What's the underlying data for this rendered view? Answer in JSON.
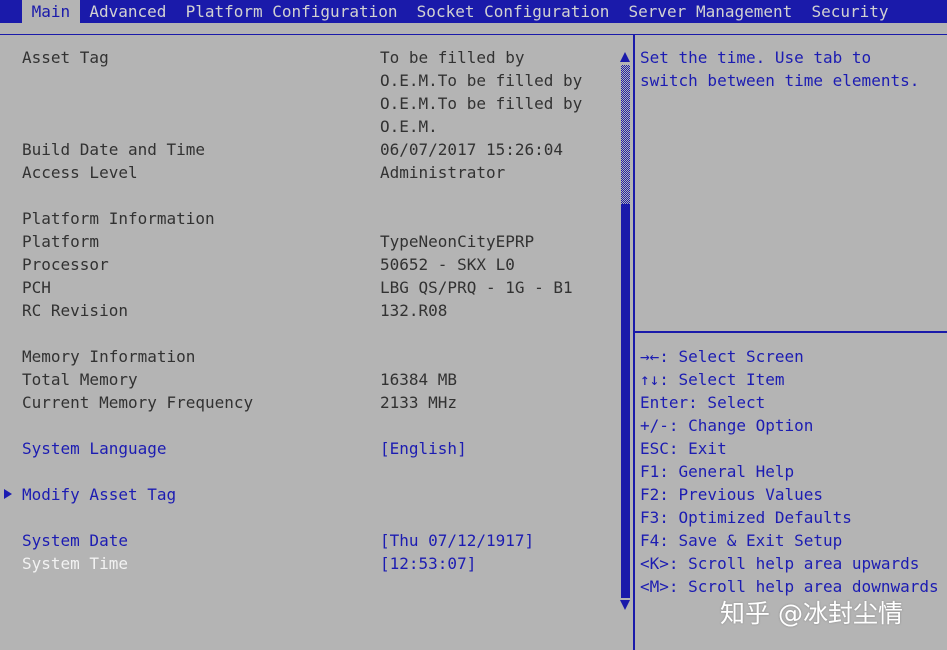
{
  "colors": {
    "bar_blue": "#1A1AAA",
    "panel_gray": "#B4B4B4",
    "text_dark": "#323232",
    "text_blue": "#1C1CB2",
    "text_white": "#F2F2F2",
    "tab_text": "#D2D2D2",
    "watermark": "#FFFFFF"
  },
  "icons": {
    "submenu_marker": "triangle-right",
    "scroll_up": "triangle-up",
    "scroll_down": "triangle-down"
  },
  "tabs": [
    {
      "label": "Main",
      "selected": true
    },
    {
      "label": "Advanced",
      "selected": false
    },
    {
      "label": "Platform Configuration",
      "selected": false
    },
    {
      "label": "Socket Configuration",
      "selected": false
    },
    {
      "label": "Server Management",
      "selected": false
    },
    {
      "label": "Security",
      "selected": false
    }
  ],
  "main": {
    "asset_tag": {
      "label": "Asset Tag",
      "value_lines": [
        "To be filled by",
        "O.E.M.To be filled by",
        "O.E.M.To be filled by",
        "O.E.M."
      ]
    },
    "build_date": {
      "label": "Build Date and Time",
      "value": "06/07/2017 15:26:04"
    },
    "access_level": {
      "label": "Access Level",
      "value": "Administrator"
    },
    "platform_heading": "Platform Information",
    "platform": {
      "label": "Platform",
      "value": "TypeNeonCityEPRP"
    },
    "processor": {
      "label": "Processor",
      "value": "50652 - SKX L0"
    },
    "pch": {
      "label": "PCH",
      "value": "LBG QS/PRQ - 1G - B1"
    },
    "rc_revision": {
      "label": "RC Revision",
      "value": "132.R08"
    },
    "memory_heading": "Memory Information",
    "total_memory": {
      "label": "Total Memory",
      "value": "16384 MB"
    },
    "memory_frequency": {
      "label": "Current Memory Frequency",
      "value": "2133 MHz"
    },
    "system_language": {
      "label": "System Language",
      "value": "[English]"
    },
    "modify_asset_tag": {
      "label": "Modify Asset Tag"
    },
    "system_date": {
      "label": "System Date",
      "value": "[Thu 07/12/1917]"
    },
    "system_time": {
      "label": "System Time",
      "value": "[12:53:07]",
      "selected": true
    }
  },
  "scrollbar": {
    "thumb_offset_percent": 26,
    "thumb_size_percent": 74
  },
  "help": {
    "description_lines": [
      "Set the time. Use tab to",
      "switch between time elements."
    ],
    "keys": [
      "→←: Select Screen",
      "↑↓: Select Item",
      "Enter: Select",
      "+/-: Change Option",
      "ESC: Exit",
      "F1: General Help",
      "F2: Previous Values",
      "F3: Optimized Defaults",
      "F4: Save & Exit Setup",
      "<K>: Scroll help area upwards",
      "<M>: Scroll help area downwards"
    ]
  },
  "watermark": "知乎 @冰封尘情"
}
